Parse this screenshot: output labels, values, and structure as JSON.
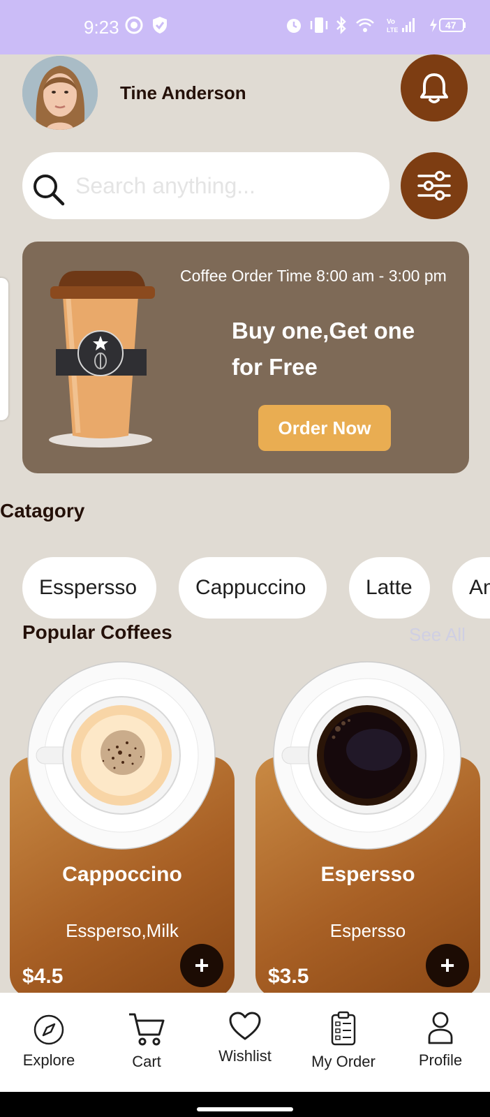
{
  "status_bar": {
    "time": "9:23",
    "battery": "47",
    "icons": [
      "sync-icon",
      "shield-icon",
      "alarm-icon",
      "vibrate-icon",
      "bluetooth-icon",
      "wifi-icon",
      "volte-signal-icon",
      "charging-battery-icon"
    ]
  },
  "header": {
    "user_name": "Tine Anderson",
    "notification_icon": "bell-icon"
  },
  "search": {
    "placeholder": "Search anything...",
    "icon": "search-icon",
    "filter_icon": "sliders-icon"
  },
  "banner": {
    "time_text": "Coffee Order Time 8:00 am - 3:00 pm",
    "promo_line1": "Buy one,Get one",
    "promo_line2": "for Free",
    "button_label": "Order Now",
    "colors": {
      "background": "#7e6a57",
      "button": "#e9ad52"
    }
  },
  "category": {
    "title": "Catagory",
    "items": [
      "Esspersso",
      "Cappuccino",
      "Latte",
      "Americano"
    ]
  },
  "popular": {
    "title": "Popular Coffees",
    "see_all": "See All",
    "items": [
      {
        "name": "Cappoccino",
        "description": "Essperso,Milk",
        "price": "$4.5",
        "add_label": "+"
      },
      {
        "name": "Espersso",
        "description": "Espersso",
        "price": "$3.5",
        "add_label": "+"
      }
    ]
  },
  "bottom_nav": {
    "items": [
      {
        "label": "Explore",
        "icon": "compass-icon"
      },
      {
        "label": "Cart",
        "icon": "cart-icon"
      },
      {
        "label": "Wishlist",
        "icon": "heart-icon"
      },
      {
        "label": "My Order",
        "icon": "clipboard-icon"
      },
      {
        "label": "Profile",
        "icon": "user-icon"
      }
    ]
  },
  "colors": {
    "accent_brown": "#7d3d12",
    "background": "#e0dbd3",
    "status_bar": "#cbbcf7",
    "card_gradient": [
      "#c98a44",
      "#8a4715"
    ]
  }
}
